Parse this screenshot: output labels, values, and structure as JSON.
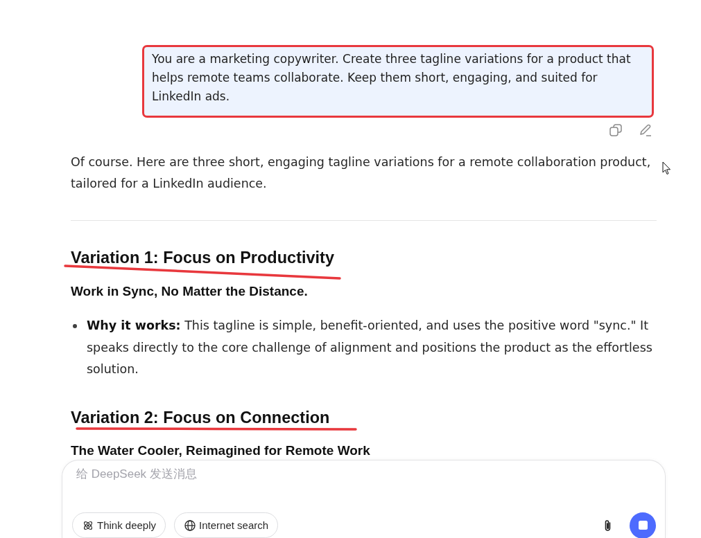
{
  "user_message": {
    "text": "You are a marketing copywriter. Create three tagline variations for a product that helps remote teams collaborate. Keep them short, engaging, and suited for LinkedIn ads.",
    "highlighted": true
  },
  "response": {
    "intro": "Of course. Here are three short, engaging tagline variations for a remote collaboration product, tailored for a LinkedIn audience.",
    "sections": [
      {
        "heading": "Variation 1: Focus on Productivity",
        "underlined": true,
        "tagline": "Work in Sync, No Matter the Distance.",
        "points": [
          "**Why it works:** This tagline is simple, benefit-oriented, and uses the positive word \"sync.\" It speaks directly to the core challenge of alignment and positions the product as the effortless solution."
        ]
      },
      {
        "heading": "Variation 2: Focus on Connection",
        "underlined": true,
        "tagline": "The Water Cooler, Reimagined for Remote Work"
      }
    ]
  },
  "composer": {
    "placeholder": "给 DeepSeek 发送消息",
    "options": [
      {
        "kind": "think",
        "label": "Think deeply",
        "selected": false
      },
      {
        "kind": "search",
        "label": "Internet search",
        "selected": false
      }
    ]
  }
}
